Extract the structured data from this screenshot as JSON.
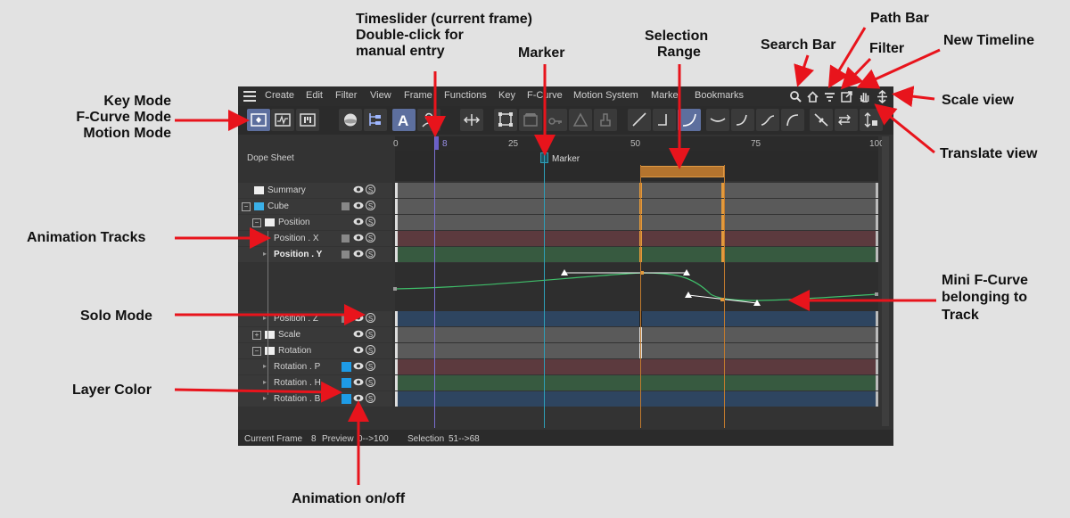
{
  "annotations": {
    "key_mode": "Key Mode",
    "fcurve_mode": "F-Curve Mode",
    "motion_mode": "Motion Mode",
    "timeslider_1": "Timeslider (current frame)",
    "timeslider_2": "Double-click for",
    "timeslider_3": "manual entry",
    "marker": "Marker",
    "selection_1": "Selection",
    "selection_2": "Range",
    "search_bar": "Search Bar",
    "path_bar": "Path Bar",
    "filter": "Filter",
    "new_timeline": "New Timeline",
    "scale_view": "Scale view",
    "translate_view": "Translate view",
    "animation_tracks": "Animation Tracks",
    "solo_mode": "Solo Mode",
    "layer_color": "Layer Color",
    "mini_fcurve_1": "Mini F-Curve",
    "mini_fcurve_2": "belonging to",
    "mini_fcurve_3": "Track",
    "animation_onoff": "Animation on/off"
  },
  "menu": [
    "Create",
    "Edit",
    "Filter",
    "View",
    "Frame",
    "Functions",
    "Key",
    "F-Curve",
    "Motion System",
    "Marker",
    "Bookmarks"
  ],
  "dope_sheet_label": "Dope Sheet",
  "ruler": {
    "ticks": [
      "0",
      "25",
      "50",
      "75",
      "100"
    ],
    "current_frame": "8"
  },
  "marker_label": "Marker",
  "tracks": [
    {
      "label": "Summary",
      "color": "#5a5a5a"
    },
    {
      "label": "Cube",
      "color": "#5a5a5a"
    },
    {
      "label": "Position",
      "color": "#5a5a5a"
    },
    {
      "label": "Position . X",
      "color": "#5c3a3e"
    },
    {
      "label": "Position . Y",
      "color": "#375a40"
    },
    {
      "label": "Position . Z",
      "color": "#2e4560"
    },
    {
      "label": "Scale",
      "color": "#5a5a5a"
    },
    {
      "label": "Rotation",
      "color": "#5a5a5a"
    },
    {
      "label": "Rotation . P",
      "color": "#5c3a3e"
    },
    {
      "label": "Rotation . H",
      "color": "#375a40"
    },
    {
      "label": "Rotation . B",
      "color": "#2e4560"
    }
  ],
  "status": {
    "current_frame_label": "Current Frame",
    "current_frame_value": "8",
    "preview_label": "Preview",
    "preview_value": "0-->100",
    "selection_label": "Selection",
    "selection_value": "51-->68"
  },
  "colors": {
    "annotation_arrow": "#e8141c",
    "selection_range": "#c07a2e",
    "marker_line": "#2e9fb8",
    "fcurve": "#3fbf6a",
    "timeslider": "#7a6fd0",
    "layer_color": "#1e9be6"
  },
  "icons": {
    "toolbar": [
      "key-mode-icon",
      "fcurve-mode-icon",
      "motion-mode-icon",
      "sphere-icon",
      "hierarchy-icon",
      "auto-key-icon",
      "person-icon",
      "move-icon",
      "frame-all-icon",
      "clapper-icon",
      "key-icon",
      "triangle-icon",
      "weight-icon",
      "linear-icon",
      "step-icon",
      "spline-icon",
      "ease-in-icon",
      "ease-out-icon",
      "ease-ease-icon",
      "curve-icon",
      "break-tangent-icon",
      "lock-tangent-icon",
      "lock-vertical-icon"
    ],
    "topright": [
      "search-icon",
      "home-path-icon",
      "filter-icon",
      "new-timeline-icon",
      "translate-view-icon",
      "scale-view-icon"
    ]
  }
}
